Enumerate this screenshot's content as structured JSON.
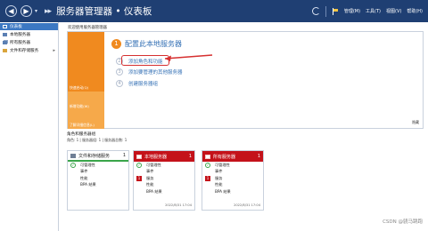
{
  "titlebar": {
    "title_arrows": "▸▸",
    "title": "服务器管理器 • 仪表板",
    "manage": "管理(M)",
    "tools": "工具(T)",
    "view": "视图(V)",
    "help": "帮助(H)",
    "back_icon": "back-icon",
    "forward_icon": "forward-icon",
    "refresh_icon": "refresh-icon",
    "flag_icon": "notification-flag-icon"
  },
  "sidebar": {
    "items": [
      {
        "label": "仪表板",
        "icon": "dashboard-icon",
        "active": true
      },
      {
        "label": "本地服务器",
        "icon": "server-icon",
        "active": false
      },
      {
        "label": "所有服务器",
        "icon": "servers-icon",
        "active": false
      },
      {
        "label": "文件和存储服务",
        "icon": "file-storage-icon",
        "active": false,
        "arrow": "▸"
      }
    ]
  },
  "welcome": {
    "header": "欢迎使用服务器管理器",
    "tiles": [
      "快速启动(Q)",
      "新增功能(W)",
      "了解详细信息(L)"
    ],
    "step1_num": "1",
    "step1_text": "配置此本地服务器",
    "steps": [
      {
        "num": "2",
        "text": "添加角色和功能"
      },
      {
        "num": "3",
        "text": "添加要管理的其他服务器"
      },
      {
        "num": "4",
        "text": "创建服务器组"
      }
    ],
    "hide": "隐藏"
  },
  "roles": {
    "header": "角色和服务器组",
    "sub": "角色: 1 | 服务器组: 1 | 服务器总数: 1"
  },
  "cards": [
    {
      "title": "文件和存储服务",
      "count": "1",
      "color": "green",
      "rows": [
        {
          "label": "可管理性",
          "mark": "ok"
        },
        {
          "label": "事件",
          "mark": ""
        },
        {
          "label": "性能",
          "mark": ""
        },
        {
          "label": "BPA 结果",
          "mark": ""
        }
      ],
      "time": ""
    },
    {
      "title": "本地服务器",
      "count": "1",
      "color": "red",
      "rows": [
        {
          "label": "可管理性",
          "mark": "ok"
        },
        {
          "label": "事件",
          "mark": ""
        },
        {
          "label": "服务",
          "mark": "err",
          "badge": "1"
        },
        {
          "label": "性能",
          "mark": ""
        },
        {
          "label": "BPA 结果",
          "mark": ""
        }
      ],
      "time": "2022/8/31 17:04"
    },
    {
      "title": "所有服务器",
      "count": "1",
      "color": "red",
      "rows": [
        {
          "label": "可管理性",
          "mark": "ok"
        },
        {
          "label": "事件",
          "mark": ""
        },
        {
          "label": "服务",
          "mark": "err",
          "badge": "1"
        },
        {
          "label": "性能",
          "mark": ""
        },
        {
          "label": "BPA 结果",
          "mark": ""
        }
      ],
      "time": "2022/8/31 17:04"
    }
  ],
  "watermark": "CSDN @骁马跳跑",
  "colors": {
    "titlebar": "#1f3f73",
    "accent_orange": "#f08a1f",
    "link_blue": "#3571b5",
    "alert_red": "#c4121a",
    "ok_green": "#3aa54a"
  }
}
